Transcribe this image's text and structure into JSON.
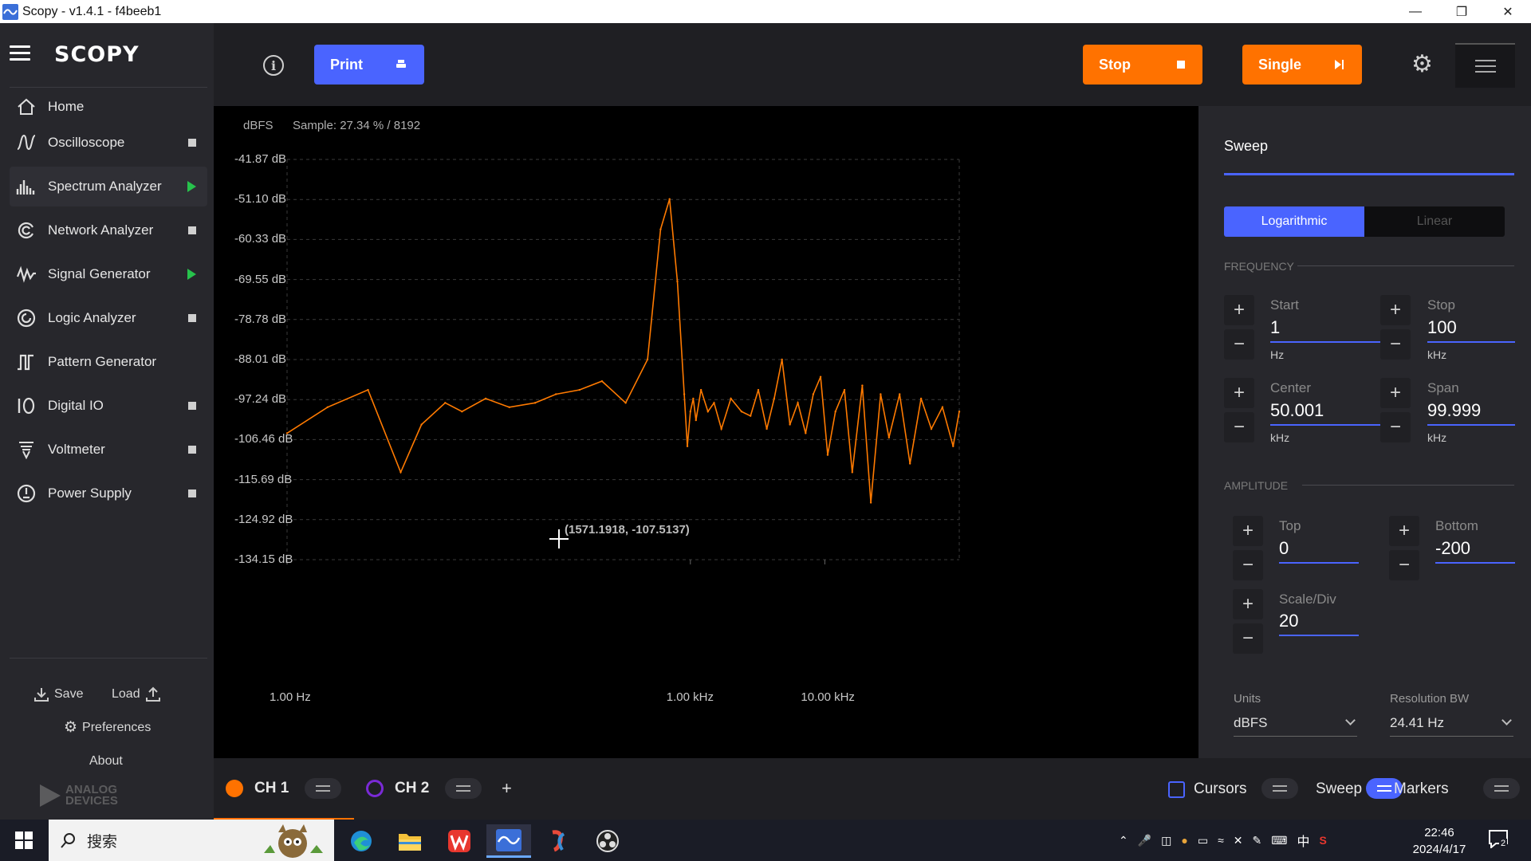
{
  "window": {
    "title": "Scopy - v1.4.1 - f4beeb1"
  },
  "sidebar": {
    "logo": "SCOPY",
    "home": "Home",
    "items": [
      {
        "label": "Oscilloscope",
        "status": "stopped"
      },
      {
        "label": "Spectrum Analyzer",
        "status": "running"
      },
      {
        "label": "Network Analyzer",
        "status": "stopped"
      },
      {
        "label": "Signal Generator",
        "status": "running"
      },
      {
        "label": "Logic Analyzer",
        "status": "stopped"
      },
      {
        "label": "Pattern Generator",
        "status": "none"
      },
      {
        "label": "Digital IO",
        "status": "stopped"
      },
      {
        "label": "Voltmeter",
        "status": "stopped"
      },
      {
        "label": "Power Supply",
        "status": "stopped"
      }
    ],
    "save": "Save",
    "load": "Load",
    "preferences": "Preferences",
    "about": "About",
    "brand_line1": "ANALOG",
    "brand_line2": "DEVICES"
  },
  "toolbar": {
    "print_label": "Print",
    "stop_label": "Stop",
    "single_label": "Single",
    "colors": {
      "print": "#4a64ff",
      "run": "#ff7200"
    }
  },
  "plot": {
    "units_label": "dBFS",
    "sample_text": "Sample: 27.34 % / 8192",
    "cursor_readout": "(1571.1918, -107.5137)",
    "trace_color": "#ff7a00"
  },
  "chart_data": {
    "type": "line",
    "title": "",
    "xlabel": "",
    "ylabel": "dBFS",
    "x_scale": "log",
    "xlim_hz": [
      1,
      100000
    ],
    "ylim": [
      -134.15,
      -41.87
    ],
    "y_ticks": [
      "-41.87 dB",
      "-51.10 dB",
      "-60.33 dB",
      "-69.55 dB",
      "-78.78 dB",
      "-88.01 dB",
      "-97.24 dB",
      "-106.46 dB",
      "-115.69 dB",
      "-124.92 dB",
      "-134.15 dB"
    ],
    "x_ticks": [
      "1.00 Hz",
      "1.00 kHz",
      "10.00 kHz"
    ],
    "x_tick_values_hz": [
      1,
      1000,
      10000
    ],
    "grid": true,
    "series": [
      {
        "color": "#ff7a00",
        "x": [
          1,
          2,
          4,
          7,
          10,
          15,
          20,
          30,
          45,
          70,
          100,
          150,
          220,
          330,
          480,
          600,
          700,
          800,
          900,
          950,
          1000,
          1050,
          1100,
          1200,
          1350,
          1500,
          1700,
          2000,
          2400,
          2800,
          3200,
          3700,
          4200,
          4800,
          5500,
          6300,
          7200,
          8200,
          9300,
          10500,
          12000,
          14000,
          16000,
          19000,
          22000,
          26000,
          30000,
          36000,
          43000,
          52000,
          62000,
          75000,
          90000,
          100000
        ],
        "values": [
          -105,
          -99,
          -95,
          -114,
          -103,
          -98,
          -100,
          -97,
          -99,
          -98,
          -96,
          -95,
          -93,
          -98,
          -88,
          -58,
          -51,
          -70,
          -96,
          -108,
          -100,
          -97,
          -102,
          -95,
          -100,
          -98,
          -104,
          -97,
          -100,
          -101,
          -95,
          -104,
          -97,
          -88,
          -103,
          -98,
          -105,
          -96,
          -92,
          -110,
          -100,
          -95,
          -114,
          -94,
          -121,
          -96,
          -106,
          -96,
          -112,
          -97,
          -104,
          -99,
          -108,
          -100
        ]
      }
    ]
  },
  "sweep_panel": {
    "title": "Sweep",
    "log_label": "Logarithmic",
    "lin_label": "Linear",
    "frequency_label": "FREQUENCY",
    "start": {
      "label": "Start",
      "value": "1",
      "unit": "Hz"
    },
    "stop": {
      "label": "Stop",
      "value": "100",
      "unit": "kHz"
    },
    "center": {
      "label": "Center",
      "value": "50.001",
      "unit": "kHz"
    },
    "span": {
      "label": "Span",
      "value": "99.999",
      "unit": "kHz"
    },
    "amplitude_label": "AMPLITUDE",
    "top": {
      "label": "Top",
      "value": "0"
    },
    "bottom": {
      "label": "Bottom",
      "value": "-200"
    },
    "scale": {
      "label": "Scale/Div",
      "value": "20"
    },
    "units": {
      "label": "Units",
      "value": "dBFS"
    },
    "rbw": {
      "label": "Resolution BW",
      "value": "24.41 Hz"
    }
  },
  "bottombar": {
    "ch1": "CH 1",
    "ch2": "CH 2",
    "add": "+",
    "cursors": "Cursors",
    "sweep": "Sweep",
    "markers": "Markers",
    "colors": {
      "ch1": "#ff7200",
      "ch2": "#7a2ad6",
      "accent": "#4a64ff"
    }
  },
  "taskbar": {
    "search_text": "搜索",
    "time": "22:46",
    "date": "2024/4/17",
    "ime": "中",
    "notification_count": "2"
  }
}
